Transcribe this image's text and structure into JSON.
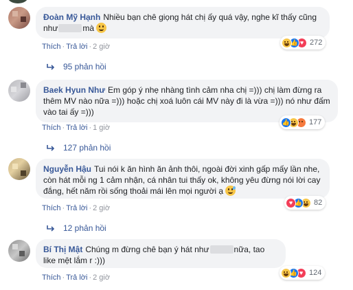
{
  "comments": [
    {
      "author": "Đoàn Mỹ Hạnh",
      "text_before": "Nhiều bạn chê giọng hát chị ấy quá vậy, nghe kĩ thấy cũng như",
      "text_after": "mà",
      "like_label": "Thích",
      "reply_label": "Trả lời",
      "time": "2 giờ",
      "reaction_icons": [
        "haha-icon",
        "like-icon",
        "love-icon"
      ],
      "reaction_count": "272",
      "replies_label": "95 phản hồi"
    },
    {
      "author": "Baek Hyun Như",
      "text": "Em góp ý nhẹ nhàng tình cảm nha chị =))) chị làm đừng ra thêm MV nào nữa =))) hoặc chị xoá luôn cái MV này đi là vừa =))) nó như đấm vào tai ấy =)))",
      "like_label": "Thích",
      "reply_label": "Trả lời",
      "time": "1 giờ",
      "reaction_icons": [
        "like-icon",
        "haha-icon",
        "angry-icon"
      ],
      "reaction_count": "177",
      "replies_label": "127 phản hồi"
    },
    {
      "author": "Nguyễn Hậu",
      "text": "Tui nói k ăn hình ăn ảnh thôi, ngoài đời xinh gấp mấy lần nhe, còn hát mỗi ng 1 cảm nhận, cá nhân tui thấy ok, không yêu đừng nói lời cay đắng, hết năm rồi sống thoải mái lên mọi người ạ",
      "like_label": "Thích",
      "reply_label": "Trả lời",
      "time": "2 giờ",
      "reaction_icons": [
        "love-icon",
        "like-icon",
        "haha-icon"
      ],
      "reaction_count": "82",
      "replies_label": "12 phản hồi"
    },
    {
      "author": "Bí Thị Mật",
      "text_before": "Chúng m đừng chê bạn ý hát như",
      "text_after": "nữa, tao like mệt lắm r :)))",
      "like_label": "Thích",
      "reply_label": "Trả lời",
      "time": "2 giờ",
      "reaction_icons": [
        "haha-icon",
        "like-icon",
        "love-icon"
      ],
      "reaction_count": "124"
    }
  ],
  "colors": {
    "name": "#385898",
    "bubble": "#f2f3f5",
    "meta": "#90949c",
    "like": "#1877f2",
    "love": "#f33e58",
    "haha": "#f7c648"
  }
}
